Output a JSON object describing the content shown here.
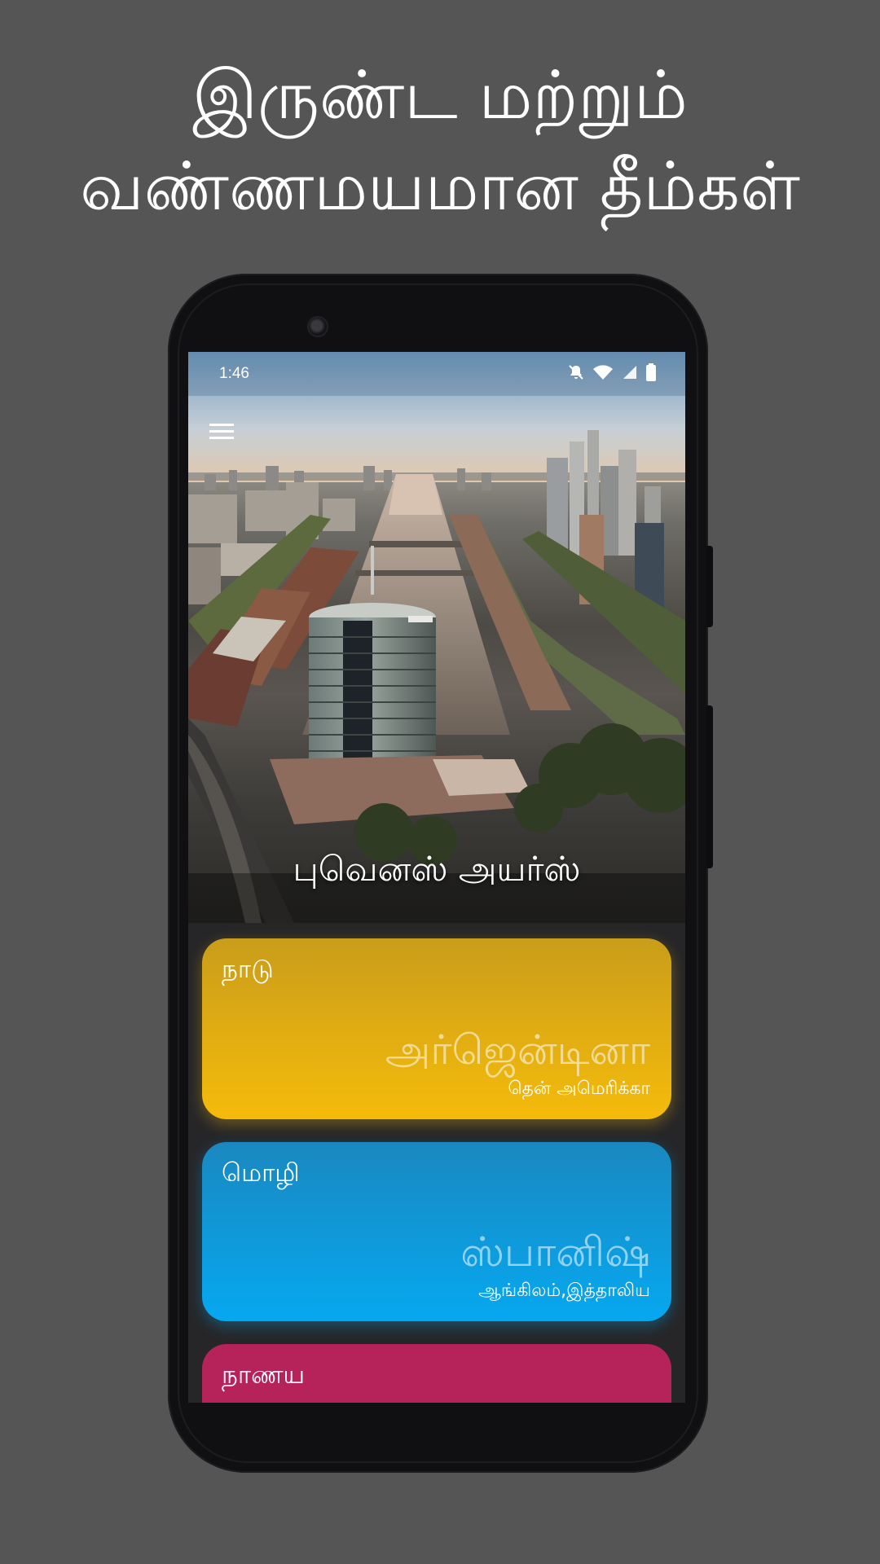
{
  "headline": {
    "line1": "இருண்ட மற்றும்",
    "line2": "வண்ணமயமான தீம்கள்"
  },
  "status_bar": {
    "time": "1:46",
    "icons": [
      "bell-off-icon",
      "wifi-icon",
      "signal-icon",
      "battery-icon"
    ]
  },
  "hero": {
    "city": "புவெனஸ் அயர்ஸ்"
  },
  "cards": {
    "country": {
      "label": "நாடு",
      "value": "அர்ஜென்டினா",
      "sub": "தென் அமெரிக்கா",
      "color": "#f5bb0b"
    },
    "language": {
      "label": "மொழி",
      "value": "ஸ்பானிஷ்",
      "sub": "ஆங்கிலம்,இத்தாலிய",
      "color": "#06a8f0"
    },
    "currency": {
      "label": "நாணய",
      "color": "#b5235a"
    }
  },
  "colors": {
    "background": "#555555",
    "phone_body": "#101012"
  }
}
